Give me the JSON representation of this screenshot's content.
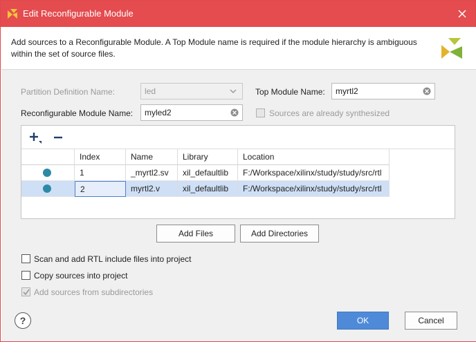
{
  "window": {
    "title": "Edit Reconfigurable Module",
    "colors": {
      "titlebar": "#e44c4f",
      "accent_button": "#4e8ad8",
      "status_dot": "#2d8aa6"
    }
  },
  "header": {
    "description": "Add sources to a Reconfigurable Module. A Top Module name is required if the module hierarchy is ambiguous within the set of source files."
  },
  "form": {
    "partition_label": "Partition Definition Name:",
    "partition_value": "led",
    "top_module_label": "Top Module Name:",
    "top_module_value": "myrtl2",
    "rm_name_label": "Reconfigurable Module Name:",
    "rm_name_value": "myled2",
    "synth_label": "Sources are already synthesized"
  },
  "table": {
    "columns": [
      "Index",
      "Name",
      "Library",
      "Location"
    ],
    "rows": [
      {
        "index": "1",
        "name": "_myrtl2.sv",
        "library": "xil_defaultlib",
        "location": "F:/Workspace/xilinx/study/study/src/rtl"
      },
      {
        "index": "2",
        "name": "myrtl2.v",
        "library": "xil_defaultlib",
        "location": "F:/Workspace/xilinx/study/study/src/rtl"
      }
    ]
  },
  "buttons": {
    "add_files": "Add Files",
    "add_directories": "Add Directories",
    "ok": "OK",
    "cancel": "Cancel",
    "help": "?"
  },
  "options": {
    "scan_rtl": "Scan and add RTL include files into project",
    "copy_sources": "Copy sources into project",
    "add_subdirs": "Add sources from subdirectories"
  }
}
